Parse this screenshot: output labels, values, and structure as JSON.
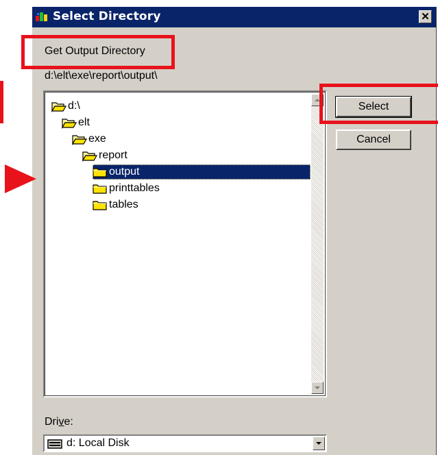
{
  "window": {
    "title": "Select Directory",
    "close_symbol": "✕"
  },
  "heading": "Get Output Directory",
  "current_path": "d:\\elt\\exe\\report\\output\\",
  "tree": {
    "items": [
      {
        "label": "d:\\",
        "icon": "open-folder-icon",
        "level": 0,
        "selected": false
      },
      {
        "label": "elt",
        "icon": "open-folder-icon",
        "level": 1,
        "selected": false
      },
      {
        "label": "exe",
        "icon": "open-folder-icon",
        "level": 2,
        "selected": false
      },
      {
        "label": "report",
        "icon": "open-folder-icon",
        "level": 3,
        "selected": false
      },
      {
        "label": "output",
        "icon": "folder-icon",
        "level": 4,
        "selected": true
      },
      {
        "label": "printtables",
        "icon": "folder-icon",
        "level": 4,
        "selected": false
      },
      {
        "label": "tables",
        "icon": "folder-icon",
        "level": 4,
        "selected": false
      }
    ]
  },
  "buttons": {
    "select_label": "Select",
    "cancel_label": "Cancel"
  },
  "drive": {
    "label_prefix": "Dri",
    "label_mnemonic": "v",
    "label_suffix": "e:",
    "selected_value": "d: Local Disk",
    "icon": "hard-drive-icon"
  },
  "colors": {
    "title_bar": "#0a246a",
    "dialog_face": "#d4d0c8",
    "selection": "#0a246a",
    "annotation_red": "#e8121b"
  }
}
